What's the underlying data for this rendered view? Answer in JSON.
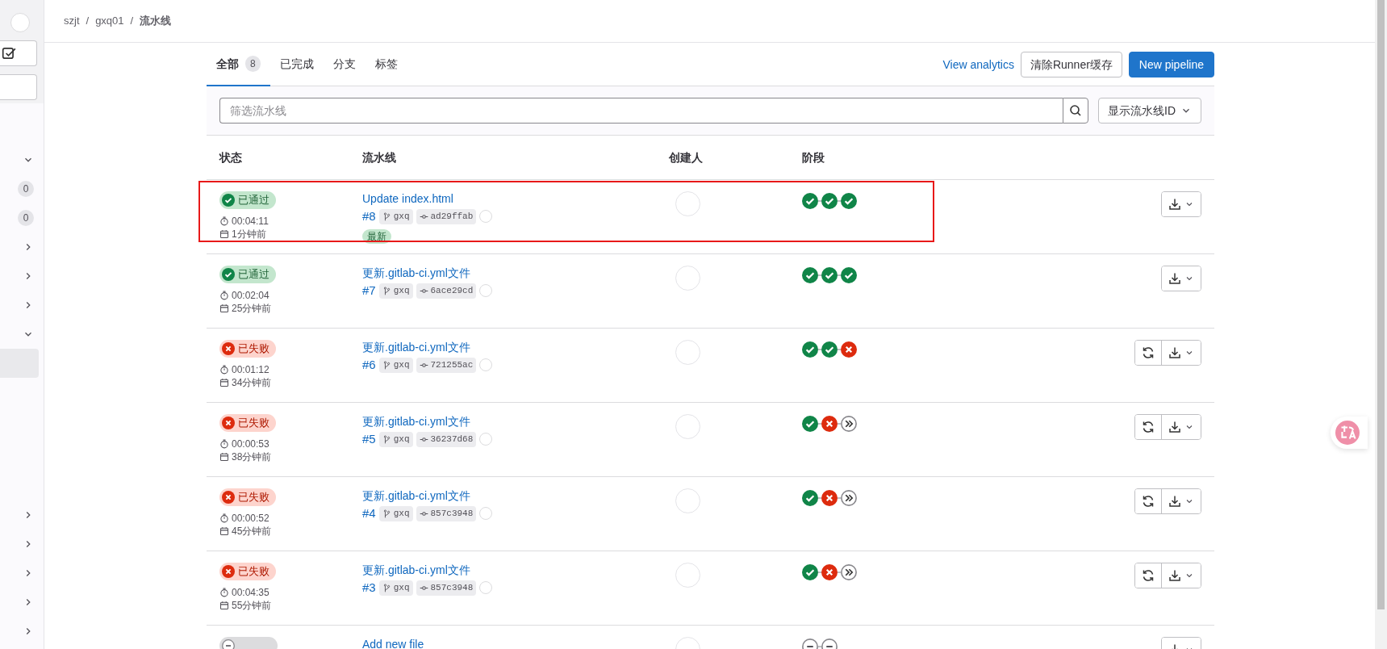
{
  "breadcrumb": [
    {
      "label": "szjt",
      "current": false
    },
    {
      "separator_before": "/",
      "label": "gxq01",
      "current": false
    },
    {
      "separator_before": "/",
      "label": "流水线",
      "current": true
    }
  ],
  "sidebar": {
    "sections": [
      {
        "items": [
          {
            "kind": "chevron-down",
            "selected": false
          },
          {
            "kind": "count",
            "count": "0",
            "selected": false
          },
          {
            "kind": "count",
            "count": "0",
            "selected": false
          },
          {
            "kind": "chevron-right",
            "selected": false
          },
          {
            "kind": "chevron-right",
            "selected": false
          },
          {
            "kind": "chevron-right",
            "selected": false
          },
          {
            "kind": "chevron-down",
            "selected": false
          },
          {
            "kind": "blank",
            "selected": true
          }
        ]
      },
      {
        "items": [
          {
            "kind": "chevron-right",
            "selected": false
          },
          {
            "kind": "chevron-right",
            "selected": false
          },
          {
            "kind": "chevron-right",
            "selected": false
          },
          {
            "kind": "chevron-right",
            "selected": false
          },
          {
            "kind": "chevron-right",
            "selected": false
          }
        ]
      }
    ]
  },
  "tabs": [
    {
      "label": "全部",
      "count": "8",
      "selected": true
    },
    {
      "label": "已完成",
      "selected": false
    },
    {
      "label": "分支",
      "selected": false
    },
    {
      "label": "标签",
      "selected": false
    }
  ],
  "actions": {
    "analytics_link": "View analytics",
    "clear_cache": "清除Runner缓存",
    "new_pipeline": "New pipeline"
  },
  "filter": {
    "placeholder": "筛选流水线",
    "display_select": "显示流水线ID"
  },
  "table": {
    "columns": [
      "状态",
      "流水线",
      "创建人",
      "阶段"
    ],
    "rows": [
      {
        "highlighted": true,
        "kind": "passed",
        "status_label": "已通过",
        "duration": "00:04:11",
        "created": "1分钟前",
        "title": "Update index.html",
        "id": "#8",
        "branch": "gxq",
        "commit": "ad29ffab",
        "badge": "最新",
        "stages": [
          {
            "kind": "success"
          },
          {
            "kind": "success"
          },
          {
            "kind": "success"
          }
        ],
        "retry": false
      },
      {
        "highlighted": false,
        "kind": "passed",
        "status_label": "已通过",
        "duration": "00:02:04",
        "created": "25分钟前",
        "title": "更新.gitlab-ci.yml文件",
        "id": "#7",
        "branch": "gxq",
        "commit": "6ace29cd",
        "stages": [
          {
            "kind": "success"
          },
          {
            "kind": "success"
          },
          {
            "kind": "success"
          }
        ],
        "retry": false
      },
      {
        "highlighted": false,
        "kind": "failed",
        "status_label": "已失败",
        "duration": "00:01:12",
        "created": "34分钟前",
        "title": "更新.gitlab-ci.yml文件",
        "id": "#6",
        "branch": "gxq",
        "commit": "721255ac",
        "stages": [
          {
            "kind": "success"
          },
          {
            "kind": "success"
          },
          {
            "kind": "failed"
          }
        ],
        "retry": true
      },
      {
        "highlighted": false,
        "kind": "failed",
        "status_label": "已失败",
        "duration": "00:00:53",
        "created": "38分钟前",
        "title": "更新.gitlab-ci.yml文件",
        "id": "#5",
        "branch": "gxq",
        "commit": "36237d68",
        "stages": [
          {
            "kind": "success"
          },
          {
            "kind": "failed"
          },
          {
            "kind": "skipped"
          }
        ],
        "retry": true
      },
      {
        "highlighted": false,
        "kind": "failed",
        "status_label": "已失败",
        "duration": "00:00:52",
        "created": "45分钟前",
        "title": "更新.gitlab-ci.yml文件",
        "id": "#4",
        "branch": "gxq",
        "commit": "857c3948",
        "stages": [
          {
            "kind": "success"
          },
          {
            "kind": "failed"
          },
          {
            "kind": "skipped"
          }
        ],
        "retry": true
      },
      {
        "highlighted": false,
        "kind": "failed",
        "status_label": "已失败",
        "duration": "00:04:35",
        "created": "55分钟前",
        "title": "更新.gitlab-ci.yml文件",
        "id": "#3",
        "branch": "gxq",
        "commit": "857c3948",
        "stages": [
          {
            "kind": "success"
          },
          {
            "kind": "failed"
          },
          {
            "kind": "skipped"
          }
        ],
        "retry": true
      },
      {
        "highlighted": false,
        "kind": "canceled",
        "title": "Add new file",
        "stages": [
          {
            "kind": "canceled"
          },
          {
            "kind": "canceled"
          }
        ],
        "retry": false
      }
    ]
  }
}
